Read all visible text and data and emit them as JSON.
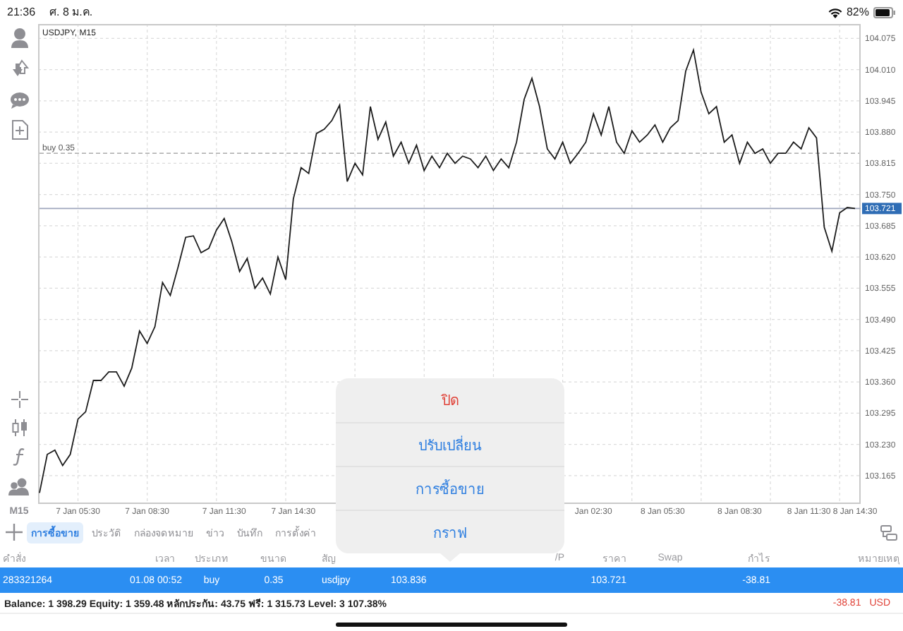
{
  "status_bar": {
    "time": "21:36",
    "date": "ศ. 8 ม.ค.",
    "battery": "82%"
  },
  "toolbar": {
    "timeframe": "M15"
  },
  "chart": {
    "chart_data": {
      "type": "line",
      "title": "USDJPY, M15",
      "categories": [
        null,
        null,
        null,
        null,
        null,
        "7 Jan 05:30",
        null,
        null,
        null,
        null,
        null,
        null,
        null,
        null,
        "7 Jan 08:30",
        null,
        null,
        null,
        null,
        null,
        null,
        null,
        null,
        null,
        "7 Jan 11:30",
        null,
        null,
        null,
        null,
        null,
        null,
        null,
        null,
        "7 Jan 14:30",
        null,
        null,
        null,
        null,
        null,
        null,
        null,
        null,
        null,
        null,
        null,
        null,
        null,
        null,
        null,
        null,
        null,
        null,
        null,
        null,
        null,
        null,
        null,
        null,
        null,
        null,
        null,
        null,
        null,
        null,
        null,
        null,
        null,
        null,
        null,
        null,
        null,
        null,
        "Jan 02:30",
        null,
        null,
        null,
        null,
        null,
        null,
        null,
        null,
        "8 Jan 05:30",
        null,
        null,
        null,
        null,
        null,
        null,
        null,
        null,
        null,
        "8 Jan 08:30",
        null,
        null,
        null,
        null,
        null,
        null,
        null,
        null,
        "8 Jan 11:30",
        null,
        null,
        null,
        null,
        null,
        "8 Jan 14:30"
      ],
      "series": [
        {
          "color": "#1c1c1c",
          "values": [
            103.129,
            103.209,
            103.218,
            103.186,
            103.209,
            103.283,
            103.298,
            103.363,
            103.363,
            103.381,
            103.381,
            103.351,
            103.389,
            103.466,
            103.44,
            103.475,
            103.567,
            103.54,
            103.599,
            103.661,
            103.664,
            103.629,
            103.638,
            103.676,
            103.7,
            103.652,
            103.59,
            103.617,
            103.555,
            103.576,
            103.543,
            103.62,
            103.573,
            103.741,
            103.806,
            103.794,
            103.877,
            103.886,
            103.904,
            103.936,
            103.777,
            103.815,
            103.791,
            103.933,
            103.865,
            103.901,
            103.83,
            103.859,
            103.815,
            103.853,
            103.8,
            103.83,
            103.806,
            103.836,
            103.815,
            103.83,
            103.824,
            103.806,
            103.83,
            103.8,
            103.824,
            103.806,
            103.859,
            103.948,
            103.992,
            103.933,
            103.845,
            103.824,
            103.859,
            103.815,
            103.836,
            103.859,
            103.918,
            103.874,
            103.933,
            103.859,
            103.836,
            103.883,
            103.859,
            103.874,
            103.895,
            103.859,
            103.889,
            103.904,
            104.007,
            104.051,
            103.963,
            103.918,
            103.933,
            103.859,
            103.874,
            103.815,
            103.859,
            103.836,
            103.845,
            103.815,
            103.836,
            103.836,
            103.859,
            103.845,
            103.889,
            103.868,
            103.682,
            103.632,
            103.712,
            103.723,
            103.721
          ]
        }
      ],
      "ylim": [
        103.106,
        104.105
      ],
      "grid": true,
      "yticks": [
        {
          "value": 104.075,
          "label": "104.075"
        },
        {
          "value": 104.01,
          "label": "104.010"
        },
        {
          "value": 103.945,
          "label": "103.945"
        },
        {
          "value": 103.88,
          "label": "103.880"
        },
        {
          "value": 103.815,
          "label": "103.815"
        },
        {
          "value": 103.75,
          "label": "103.750"
        },
        {
          "value": 103.685,
          "label": "103.685"
        },
        {
          "value": 103.62,
          "label": "103.620"
        },
        {
          "value": 103.555,
          "label": "103.555"
        },
        {
          "value": 103.49,
          "label": "103.490"
        },
        {
          "value": 103.425,
          "label": "103.425"
        },
        {
          "value": 103.36,
          "label": "103.360"
        },
        {
          "value": 103.295,
          "label": "103.295"
        },
        {
          "value": 103.23,
          "label": "103.230"
        },
        {
          "value": 103.165,
          "label": "103.165"
        }
      ],
      "ref_lines": [
        {
          "axis": "y",
          "value": 103.836,
          "label": "buy 0.35"
        },
        {
          "axis": "y",
          "value": 103.721,
          "label": "103.721"
        }
      ]
    }
  },
  "tabs": [
    {
      "label": "การซื้อขาย",
      "selected": true
    },
    {
      "label": "ประวัติ",
      "selected": false
    },
    {
      "label": "กล่องจดหมาย",
      "selected": false
    },
    {
      "label": "ข่าว",
      "selected": false
    },
    {
      "label": "บันทึก",
      "selected": false
    },
    {
      "label": "การตั้งค่า",
      "selected": false
    }
  ],
  "table": {
    "columns": [
      {
        "label": "คำสั่ง"
      },
      {
        "label": "เวลา"
      },
      {
        "label": "ประเภท"
      },
      {
        "label": "ขนาด"
      },
      {
        "label": "สัญ"
      },
      {
        "label": "/P"
      },
      {
        "label": "ราคา"
      },
      {
        "label": "Swap"
      },
      {
        "label": "กำไร"
      },
      {
        "label": "หมายเหตุ"
      }
    ],
    "rows": [
      {
        "selected": true,
        "cells": {
          "order": "283321264",
          "time": "01.08 00:52",
          "type": "buy",
          "volume": "0.35",
          "symbol": "usdjpy",
          "open_price": "103.836",
          "price": "103.721",
          "profit": "-38.81"
        }
      }
    ]
  },
  "summary": {
    "text": "Balance: 1 398.29 Equity: 1 359.48 หลักประกัน: 43.75 ฟรี: 1 315.73 Level: 3 107.38%",
    "profit": "-38.81",
    "currency": "USD"
  },
  "popover": {
    "items": [
      {
        "label": "ปิด",
        "kind": "destructive"
      },
      {
        "label": "ปรับเปลี่ยน",
        "kind": "action"
      },
      {
        "label": "การซื้อขาย",
        "kind": "action"
      },
      {
        "label": "กราฟ",
        "kind": "action"
      }
    ]
  }
}
